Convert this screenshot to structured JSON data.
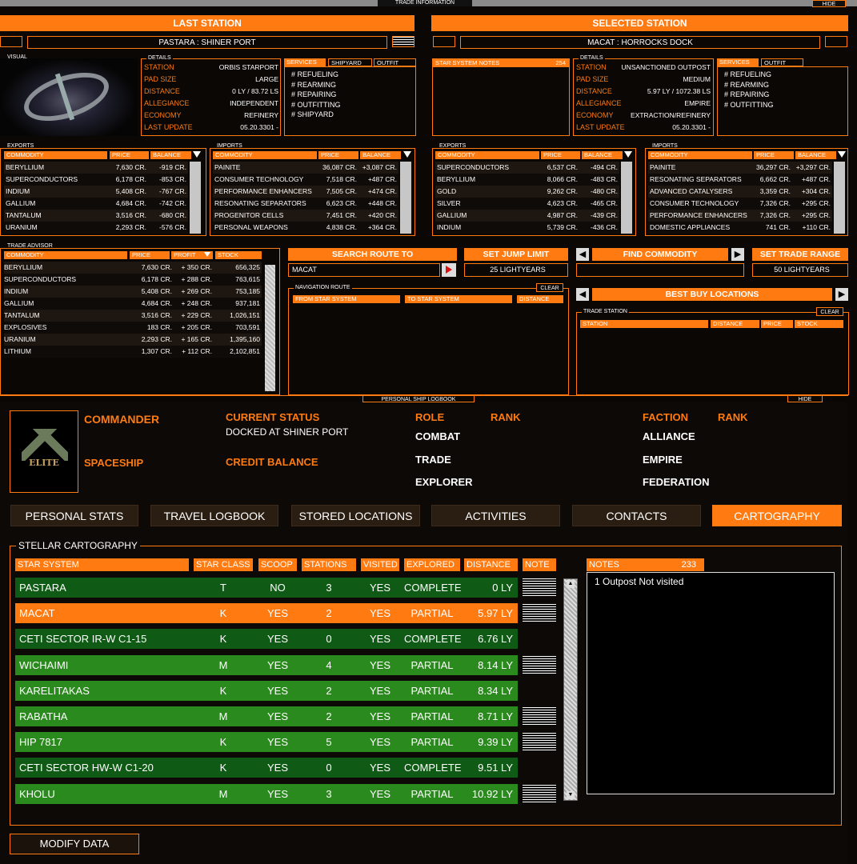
{
  "topbar": {
    "title": "TRADE INFORMATION",
    "hide": "HIDE"
  },
  "last_station": {
    "header": "LAST STATION",
    "name": "PASTARA : SHINER PORT",
    "visual_label": "VISUAL",
    "details_label": "DETAILS",
    "details": [
      {
        "k": "STATION",
        "v": "ORBIS STARPORT"
      },
      {
        "k": "PAD SIZE",
        "v": "LARGE"
      },
      {
        "k": "DISTANCE",
        "v": "0 LY / 83.72 LS"
      },
      {
        "k": "ALLEGIANCE",
        "v": "INDEPENDENT"
      },
      {
        "k": "ECONOMY",
        "v": "REFINERY"
      },
      {
        "k": "LAST UPDATE",
        "v": "05.20.3301 -"
      }
    ],
    "service_tabs": [
      "SERVICES",
      "SHIPYARD",
      "OUTFIT"
    ],
    "services": [
      "# REFUELING",
      "# REARMING",
      "# REPAIRING",
      "# OUTFITTING",
      "# SHIPYARD"
    ],
    "exports_label": "EXPORTS",
    "imports_label": "IMPORTS",
    "exports": [
      [
        "BERYLLIUM",
        "7,630 CR.",
        "-919 CR."
      ],
      [
        "SUPERCONDUCTORS",
        "6,178 CR.",
        "-853 CR."
      ],
      [
        "INDIUM",
        "5,408 CR.",
        "-767 CR."
      ],
      [
        "GALLIUM",
        "4,684 CR.",
        "-742 CR."
      ],
      [
        "TANTALUM",
        "3,516 CR.",
        "-680 CR."
      ],
      [
        "URANIUM",
        "2,293 CR.",
        "-576 CR."
      ]
    ],
    "imports": [
      [
        "PAINITE",
        "36,087 CR.",
        "+3,087 CR."
      ],
      [
        "CONSUMER TECHNOLOGY",
        "7,518 CR.",
        "+487 CR."
      ],
      [
        "PERFORMANCE ENHANCERS",
        "7,505 CR.",
        "+474 CR."
      ],
      [
        "RESONATING SEPARATORS",
        "6,623 CR.",
        "+448 CR."
      ],
      [
        "PROGENITOR CELLS",
        "7,451 CR.",
        "+420 CR."
      ],
      [
        "PERSONAL WEAPONS",
        "4,838 CR.",
        "+364 CR."
      ]
    ]
  },
  "selected_station": {
    "header": "SELECTED STATION",
    "name": "MACAT : HORROCKS DOCK",
    "notes_label": "STAR SYSTEM NOTES",
    "notes_count": "254",
    "details_label": "DETAILS",
    "details": [
      {
        "k": "STATION",
        "v": "UNSANCTIONED OUTPOST"
      },
      {
        "k": "PAD SIZE",
        "v": "MEDIUM"
      },
      {
        "k": "DISTANCE",
        "v": "5.97 LY / 1072.38 LS"
      },
      {
        "k": "ALLEGIANCE",
        "v": "EMPIRE"
      },
      {
        "k": "ECONOMY",
        "v": "EXTRACTION/REFINERY"
      },
      {
        "k": "LAST UPDATE",
        "v": "05.20.3301 -"
      }
    ],
    "service_tabs": [
      "SERVICES",
      "OUTFIT"
    ],
    "services": [
      "# REFUELING",
      "# REARMING",
      "# REPAIRING",
      "# OUTFITTING"
    ],
    "exports_label": "EXPORTS",
    "imports_label": "IMPORTS",
    "exports": [
      [
        "SUPERCONDUCTORS",
        "6,537 CR.",
        "-494 CR."
      ],
      [
        "BERYLLIUM",
        "8,066 CR.",
        "-483 CR."
      ],
      [
        "GOLD",
        "9,262 CR.",
        "-480 CR."
      ],
      [
        "SILVER",
        "4,623 CR.",
        "-465 CR."
      ],
      [
        "GALLIUM",
        "4,987 CR.",
        "-439 CR."
      ],
      [
        "INDIUM",
        "5,739 CR.",
        "-436 CR."
      ]
    ],
    "imports": [
      [
        "PAINITE",
        "36,297 CR.",
        "+3,297 CR."
      ],
      [
        "RESONATING SEPARATORS",
        "6,662 CR.",
        "+487 CR."
      ],
      [
        "ADVANCED CATALYSERS",
        "3,359 CR.",
        "+304 CR."
      ],
      [
        "CONSUMER TECHNOLOGY",
        "7,326 CR.",
        "+295 CR."
      ],
      [
        "PERFORMANCE ENHANCERS",
        "7,326 CR.",
        "+295 CR."
      ],
      [
        "DOMESTIC APPLIANCES",
        "741 CR.",
        "+110 CR."
      ]
    ]
  },
  "table_headers": {
    "commodity": "COMMODITY",
    "price": "PRICE",
    "balance": "BALANCE",
    "profit": "PROFIT",
    "stock": "STOCK"
  },
  "trade_advisor": {
    "label": "TRADE ADVISOR",
    "rows": [
      [
        "BERYLLIUM",
        "7,630 CR.",
        "+ 350 CR.",
        "656,325"
      ],
      [
        "SUPERCONDUCTORS",
        "6,178 CR.",
        "+ 288 CR.",
        "763,615"
      ],
      [
        "INDIUM",
        "5,408 CR.",
        "+ 269 CR.",
        "753,185"
      ],
      [
        "GALLIUM",
        "4,684 CR.",
        "+ 248 CR.",
        "937,181"
      ],
      [
        "TANTALUM",
        "3,516 CR.",
        "+ 229 CR.",
        "1,026,151"
      ],
      [
        "EXPLOSIVES",
        "183 CR.",
        "+ 205 CR.",
        "703,591"
      ],
      [
        "URANIUM",
        "2,293 CR.",
        "+ 165 CR.",
        "1,395,160"
      ],
      [
        "LITHIUM",
        "1,307 CR.",
        "+ 112 CR.",
        "2,102,851"
      ]
    ]
  },
  "route": {
    "search_btn": "SEARCH ROUTE TO",
    "search_value": "MACAT",
    "jump_btn": "SET JUMP LIMIT",
    "jump_value": "25 LIGHTYEARS",
    "nav_label": "NAVIGATION ROUTE",
    "clear": "CLEAR",
    "cols": [
      "FROM STAR SYSTEM",
      "TO STAR SYSTEM",
      "DISTANCE"
    ]
  },
  "commodity": {
    "find_btn": "FIND COMMODITY",
    "range_btn": "SET TRADE RANGE",
    "range_value": "50 LIGHTYEARS",
    "best_buy": "BEST BUY LOCATIONS",
    "trade_station_label": "TRADE STATION",
    "clear": "CLEAR",
    "cols": [
      "STATION",
      "DISTANCE",
      "PRICE",
      "STOCK"
    ]
  },
  "logbook": {
    "title": "PERSONAL SHIP LOGBOOK",
    "hide": "HIDE",
    "commander": "COMMANDER",
    "spaceship": "SPACESHIP",
    "current_status": "CURRENT STATUS",
    "status_value": "DOCKED AT SHINER PORT",
    "credit_balance": "CREDIT BALANCE",
    "role": "ROLE",
    "rank": "RANK",
    "roles": [
      "COMBAT",
      "TRADE",
      "EXPLORER"
    ],
    "faction": "FACTION",
    "faction_rank": "RANK",
    "factions": [
      "ALLIANCE",
      "EMPIRE",
      "FEDERATION"
    ],
    "logo_text": "ELITE"
  },
  "tabs": [
    "PERSONAL STATS",
    "TRAVEL LOGBOOK",
    "STORED LOCATIONS",
    "ACTIVITIES",
    "CONTACTS",
    "CARTOGRAPHY"
  ],
  "cartography": {
    "label": "STELLAR CARTOGRAPHY",
    "cols": [
      "STAR SYSTEM",
      "STAR CLASS",
      "SCOOP",
      "STATIONS",
      "VISITED",
      "EXPLORED",
      "DISTANCE",
      "NOTE"
    ],
    "rows": [
      [
        "PASTARA",
        "T",
        "NO",
        "3",
        "YES",
        "COMPLETE",
        "0 LY"
      ],
      [
        "MACAT",
        "K",
        "YES",
        "2",
        "YES",
        "PARTIAL",
        "5.97 LY"
      ],
      [
        "CETI SECTOR IR-W C1-15",
        "K",
        "YES",
        "0",
        "YES",
        "COMPLETE",
        "6.76 LY"
      ],
      [
        "WICHAIMI",
        "M",
        "YES",
        "4",
        "YES",
        "PARTIAL",
        "8.14 LY"
      ],
      [
        "KARELITAKAS",
        "K",
        "YES",
        "2",
        "YES",
        "PARTIAL",
        "8.34 LY"
      ],
      [
        "RABATHA",
        "M",
        "YES",
        "2",
        "YES",
        "PARTIAL",
        "8.71 LY"
      ],
      [
        "HIP 7817",
        "K",
        "YES",
        "5",
        "YES",
        "PARTIAL",
        "9.39 LY"
      ],
      [
        "CETI SECTOR HW-W C1-20",
        "K",
        "YES",
        "0",
        "YES",
        "COMPLETE",
        "9.51 LY"
      ],
      [
        "KHOLU",
        "M",
        "YES",
        "3",
        "YES",
        "PARTIAL",
        "10.92 LY"
      ]
    ],
    "notes_label": "NOTES",
    "notes_count": "233",
    "notes_text": "1 Outpost Not visited"
  },
  "modify_btn": "MODIFY DATA",
  "colors": {
    "orange": "#ff7b11",
    "dark_green": "#0f5a14",
    "green": "#2b8a1e"
  }
}
